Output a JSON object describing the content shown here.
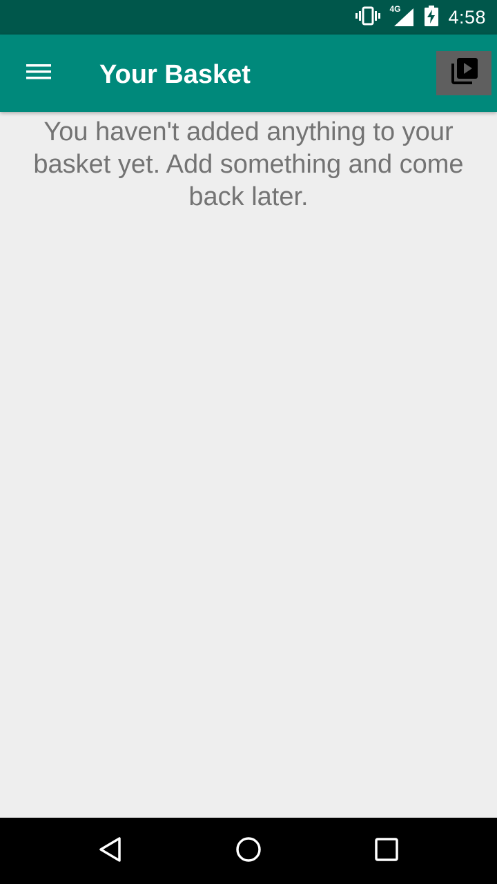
{
  "status_bar": {
    "time": "4:58",
    "network_label": "4G",
    "icons": [
      "vibrate-icon",
      "signal-icon",
      "battery-charging-icon"
    ]
  },
  "app_bar": {
    "title": "Your Basket",
    "menu_icon": "hamburger-menu-icon",
    "action_icon": "video-library-icon",
    "color": "#00897b"
  },
  "content": {
    "empty_message": "You haven't added anything to your basket yet. Add something and come back later."
  },
  "nav_bar": {
    "buttons": [
      "back-icon",
      "home-icon",
      "recents-icon"
    ]
  },
  "colors": {
    "status_bar": "#00574b",
    "app_bar": "#00897b",
    "background": "#eeeeee",
    "message_text": "#737373"
  }
}
